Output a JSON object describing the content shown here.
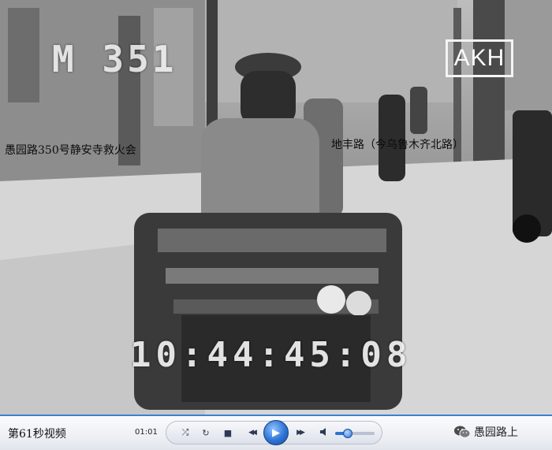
{
  "video": {
    "reel_code": "M 351",
    "watermark": "AKH",
    "timecode": "10:44:45:08",
    "caption_left": "愚园路350号静安寺救火会",
    "caption_right": "地丰路（今乌鲁木齐北路）"
  },
  "player": {
    "clip_label": "第61秒视频",
    "elapsed": "01:01",
    "buttons": {
      "shuffle": "⤮",
      "repeat": "↻",
      "stop": "■",
      "prev": "◀◀",
      "play": "▶",
      "next": "▶▶",
      "volume": "🔈"
    },
    "volume_level": 0.3,
    "accent_color": "#2e73d4"
  },
  "account": {
    "name": "愚园路上",
    "icon": "wechat-icon"
  }
}
